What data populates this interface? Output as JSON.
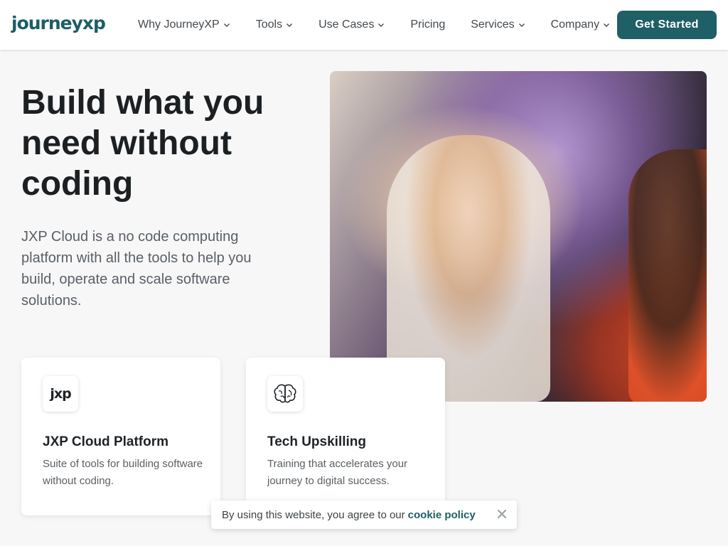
{
  "header": {
    "logo_text": "journeyxp",
    "nav": [
      {
        "label": "Why JourneyXP",
        "has_dropdown": true
      },
      {
        "label": "Tools",
        "has_dropdown": true
      },
      {
        "label": "Use Cases",
        "has_dropdown": true
      },
      {
        "label": "Pricing",
        "has_dropdown": false
      },
      {
        "label": "Services",
        "has_dropdown": true
      },
      {
        "label": "Company",
        "has_dropdown": true
      }
    ],
    "cta_label": "Get Started"
  },
  "hero": {
    "title": "Build what you need without coding",
    "description": "JXP Cloud is a no code computing platform with all the tools to help you build, operate and scale software solutions.",
    "image_icon": "hero-photo"
  },
  "cards": [
    {
      "icon": "jxp-logo-icon",
      "icon_text": "jxp",
      "title": "JXP Cloud Platform",
      "description": "Suite of tools for building software without coding."
    },
    {
      "icon": "brain-icon",
      "title": "Tech Upskilling",
      "description": "Training that accelerates your journey to digital success."
    }
  ],
  "cookie": {
    "text": "By using this website, you agree to our",
    "link_label": "cookie policy",
    "close_icon": "close-icon"
  },
  "colors": {
    "brand": "#1f5f66",
    "background": "#f7f7f8",
    "text": "#1f2326",
    "muted": "#5a6065"
  }
}
